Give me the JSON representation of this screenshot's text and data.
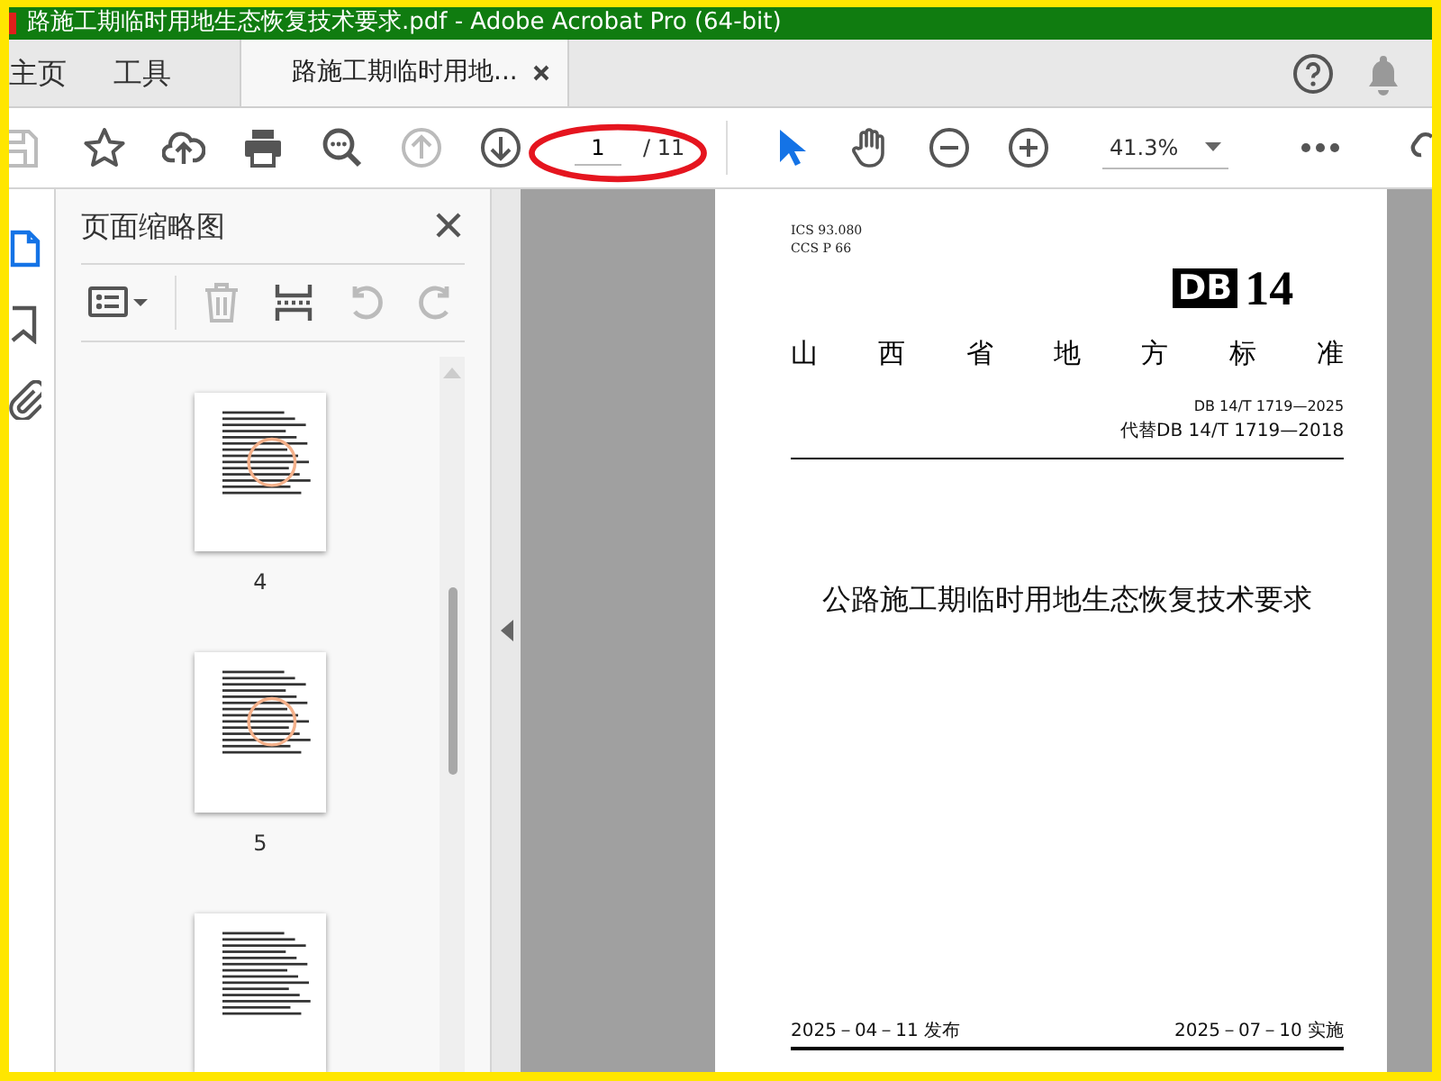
{
  "window": {
    "title": "路施工期临时用地生态恢复技术要求.pdf - Adobe Acrobat Pro (64-bit)"
  },
  "tabs": [
    {
      "label": "主页",
      "selected": false,
      "closable": false
    },
    {
      "label": "工具",
      "selected": false,
      "closable": false
    },
    {
      "label": "路施工期临时用地...",
      "selected": true,
      "closable": true
    }
  ],
  "toolbar": {
    "buttons": [
      {
        "kind": "save",
        "disabled": true
      },
      {
        "kind": "star",
        "disabled": false
      },
      {
        "kind": "upload",
        "disabled": false
      },
      {
        "kind": "print",
        "disabled": false
      },
      {
        "kind": "find",
        "disabled": false
      },
      {
        "kind": "prev",
        "disabled": true
      },
      {
        "kind": "next",
        "disabled": false
      }
    ],
    "page_field": {
      "value": "1",
      "total": "/ 11"
    },
    "tools": [
      {
        "kind": "select",
        "selected": true
      },
      {
        "kind": "hand",
        "selected": false
      },
      {
        "kind": "zoomout",
        "selected": false
      },
      {
        "kind": "zoomin",
        "selected": false
      }
    ],
    "zoom_field": {
      "value": "41.3%"
    }
  },
  "side_icons": [
    {
      "kind": "pages",
      "selected": true
    },
    {
      "kind": "bookmark",
      "selected": false
    },
    {
      "kind": "attachment",
      "selected": false
    }
  ],
  "thumbnail_panel": {
    "title": "页面缩略图",
    "tools": [
      {
        "kind": "options",
        "disabled": false
      },
      {
        "kind": "delete",
        "disabled": true
      },
      {
        "kind": "insert",
        "disabled": false
      },
      {
        "kind": "rotateccw",
        "disabled": true
      },
      {
        "kind": "rotatecw",
        "disabled": true
      }
    ],
    "thumbnails": [
      {
        "kind": "page",
        "label": "4"
      },
      {
        "kind": "page",
        "label": "5"
      },
      {
        "kind": "page"
      }
    ]
  },
  "document": {
    "ics": "ICS  93.080",
    "ccs": "CCS  P 66",
    "logo_mark": "DB",
    "logo_number": "14",
    "heading": "山西省地方标准",
    "code": "DB 14/T  1719—2025",
    "replaces": "代替DB 14/T  1719—2018",
    "title": "公路施工期临时用地生态恢复技术要求",
    "issued": "2025－04－11 发布",
    "effective": "2025－07－10 实施"
  }
}
